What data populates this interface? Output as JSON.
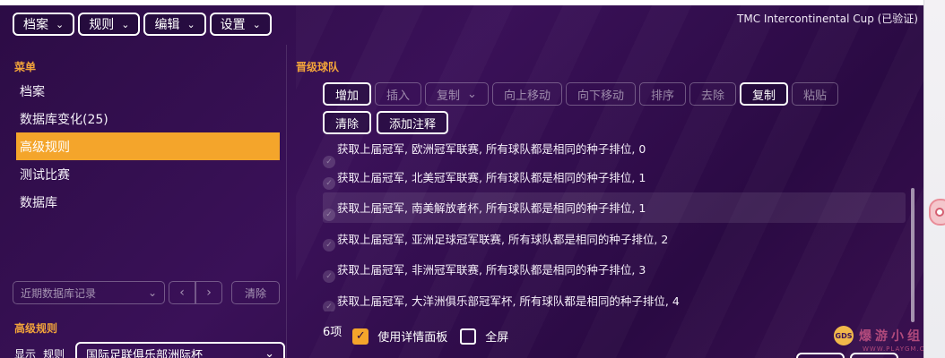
{
  "window": {
    "title": "TMC Intercontinental Cup (已验证)"
  },
  "topmenu": [
    {
      "label": "档案"
    },
    {
      "label": "规则"
    },
    {
      "label": "编辑"
    },
    {
      "label": "设置"
    }
  ],
  "left": {
    "menu_label": "菜单",
    "items": [
      {
        "label": "档案"
      },
      {
        "label": "数据库变化(25)"
      },
      {
        "label": "高级规则",
        "active": true
      },
      {
        "label": "测试比赛"
      },
      {
        "label": "数据库"
      }
    ],
    "recent_placeholder": "近期数据库记录",
    "prev_glyph": "‹",
    "next_glyph": "›",
    "clear_label": "清除",
    "adv_rules_label": "高级规则",
    "display_label": "显示",
    "rule_label": "规则",
    "rule_value": "国际足联俱乐部洲际杯"
  },
  "right": {
    "title": "晋级球队",
    "toolbar": [
      {
        "label": "增加",
        "enabled": true
      },
      {
        "label": "插入",
        "enabled": false
      },
      {
        "label": "复制",
        "enabled": false,
        "dropdown": true
      },
      {
        "label": "向上移动",
        "enabled": false
      },
      {
        "label": "向下移动",
        "enabled": false
      },
      {
        "label": "排序",
        "enabled": false
      },
      {
        "label": "去除",
        "enabled": false
      },
      {
        "label": "复制",
        "enabled": true
      },
      {
        "label": "粘贴",
        "enabled": false
      }
    ],
    "toolbar2": [
      {
        "label": "清除"
      },
      {
        "label": "添加注释"
      }
    ],
    "rows": [
      {
        "text": "获取上届冠军, 欧洲冠军联赛, 所有球队都是相同的种子排位, 0"
      },
      {
        "text": "获取上届冠军, 北美冠军联赛, 所有球队都是相同的种子排位, 1"
      },
      {
        "text": "获取上届冠军, 南美解放者杯, 所有球队都是相同的种子排位, 1",
        "highlight": true
      },
      {
        "text": "获取上届冠军, 亚洲足球冠军联赛, 所有球队都是相同的种子排位, 2"
      },
      {
        "text": "获取上届冠军, 非洲冠军联赛, 所有球队都是相同的种子排位, 3"
      },
      {
        "text": "获取上届冠军, 大洋洲俱乐部冠军杯, 所有球队都是相同的种子排位, 4"
      }
    ],
    "count_label": "6项",
    "use_detail_panel": {
      "label": "使用详情面板",
      "checked": true
    },
    "fullscreen": {
      "label": "全屏",
      "checked": false
    }
  },
  "watermark": {
    "logo": "GDS",
    "text": "爆游小组",
    "sub": "WWW.PLAYGM.CC"
  },
  "icons": {
    "chevron": "chevron-down-icon",
    "check": "checkmark-icon"
  },
  "colors": {
    "accent": "#f4a52b",
    "bg": "#2c0c45"
  }
}
